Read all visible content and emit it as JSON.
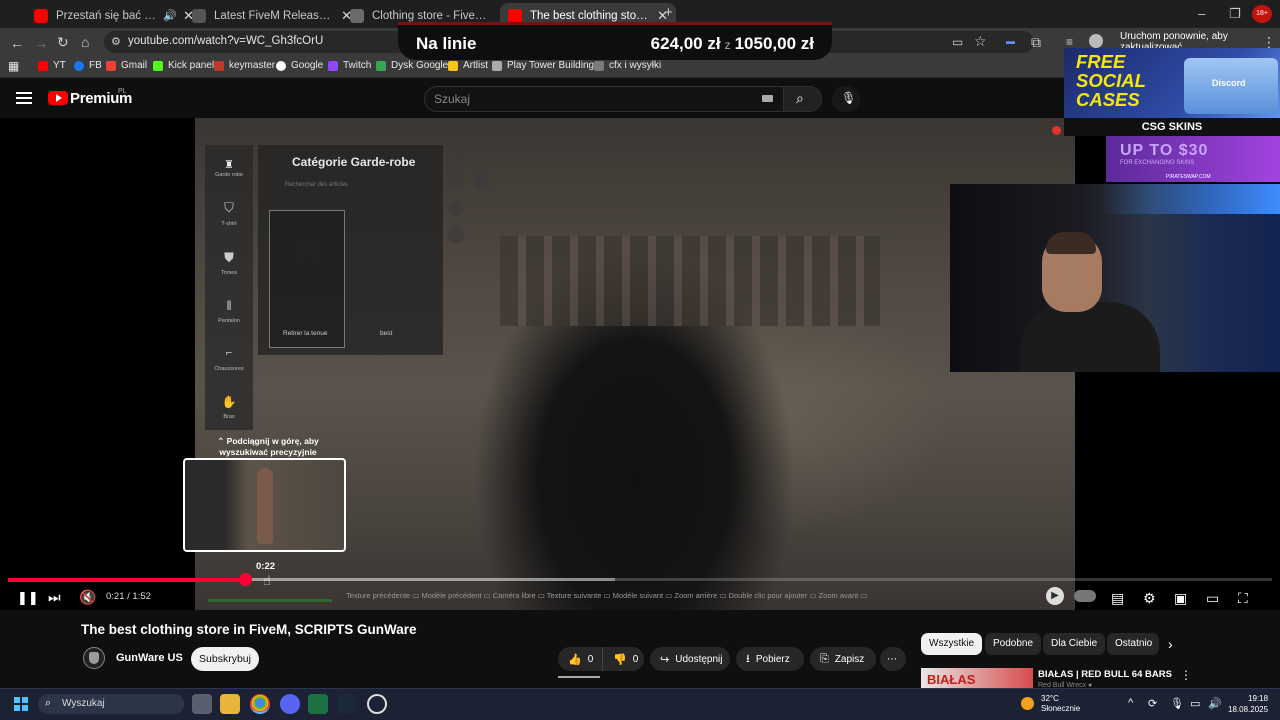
{
  "browser": {
    "tabs": [
      {
        "title": "Przestań się bać - YouTube",
        "favicon_color": "#ff0000",
        "audio": true,
        "active": false
      },
      {
        "title": "Latest FiveM Releases topics - C",
        "favicon_color": "#2a2a2a",
        "active": false
      },
      {
        "title": "Clothing store - FiveM Release",
        "favicon_color": "#3a3a3a",
        "active": false
      },
      {
        "title": "The best clothing store in FiveM",
        "favicon_color": "#ff0000",
        "active": true
      }
    ],
    "new_tab": "+",
    "window_controls": [
      "–",
      "❐",
      "✕"
    ],
    "url": "youtube.com/watch?v=WC_Gh3fcOrU",
    "restart_label": "Uruchom ponownie, aby zaktualizować",
    "bookmarks": [
      {
        "label": "YT",
        "color": "#ff0000"
      },
      {
        "label": "FB",
        "color": "#1877f2"
      },
      {
        "label": "Gmail",
        "color": "#ea4335"
      },
      {
        "label": "Kick panel",
        "color": "#53fc18"
      },
      {
        "label": "keymaster",
        "color": "#c0392b"
      },
      {
        "label": "Google",
        "color": "#ffffff"
      },
      {
        "label": "Twitch",
        "color": "#9146ff"
      },
      {
        "label": "Dysk Google",
        "color": "#34a853"
      },
      {
        "label": "Artlist",
        "color": "#f5c518"
      },
      {
        "label": "Play Tower Building...",
        "color": "#aaaaaa"
      },
      {
        "label": "cfx i wysyłki",
        "color": "#7a7a7a"
      }
    ]
  },
  "overlay": {
    "label": "Na linie",
    "current": "624,00 zł",
    "separator": "z",
    "goal": "1050,00 zł"
  },
  "youtube": {
    "logo": "Premium",
    "region": "PL",
    "search_placeholder": "Szukaj"
  },
  "game_ui": {
    "category_title": "Catégorie Garde-robe",
    "search_hint": "Rechercher des articles",
    "menu_items": [
      "Garde robe",
      "T-shirt",
      "Torses",
      "Pantalon",
      "Chaussures",
      "Bras"
    ],
    "card_left": "Retirer la tenue",
    "card_right": "best"
  },
  "hud_hints": "Texture précédente ▭   Modèle précédent ▭   Caméra libre ▭   Texture suivante ▭   Modèle suivant ▭   Zoom arrière ▭   Double clic pour ajouter ▭   Zoom avant ▭",
  "player": {
    "preview_hint": "⌃ Podciągnij w górę, aby wyszukiwać precyzyjnie",
    "preview_time": "0:22",
    "time_label": "0:21 / 1:52",
    "progress": 0.1875,
    "buffered": 0.48
  },
  "ads": {
    "ad1_text": "FREE SOCIAL CASES",
    "ad1_brand": "CSG SKINS",
    "ad1_box": "Discord",
    "ad2_text": "UP TO $30",
    "ad2_sub": "FOR EXCHANGING SKINS",
    "ad2_url": "PIRATESWAP.COM"
  },
  "video": {
    "title": "The best clothing store in FiveM, SCRIPTS GunWare",
    "channel": "GunWare US",
    "subscribe": "Subskrybuj",
    "likes": "0",
    "dislikes": "0",
    "share": "Udostępnij",
    "download": "Pobierz",
    "save": "Zapisz",
    "more": "⋯"
  },
  "sidebar": {
    "chips": [
      "Wszystkie",
      "Podobne",
      "Dla Ciebie",
      "Ostatnio"
    ],
    "rec_thumb_text": "BIAŁAS",
    "rec_title": "BIAŁAS | RED BULL 64 BARS",
    "rec_channel": "Red Bull Wrecx ●"
  },
  "taskbar": {
    "search": "Wyszukaj",
    "weather_temp": "32°C",
    "weather_desc": "Słonecznie",
    "time": "19:18",
    "date": "18.08.2025"
  }
}
